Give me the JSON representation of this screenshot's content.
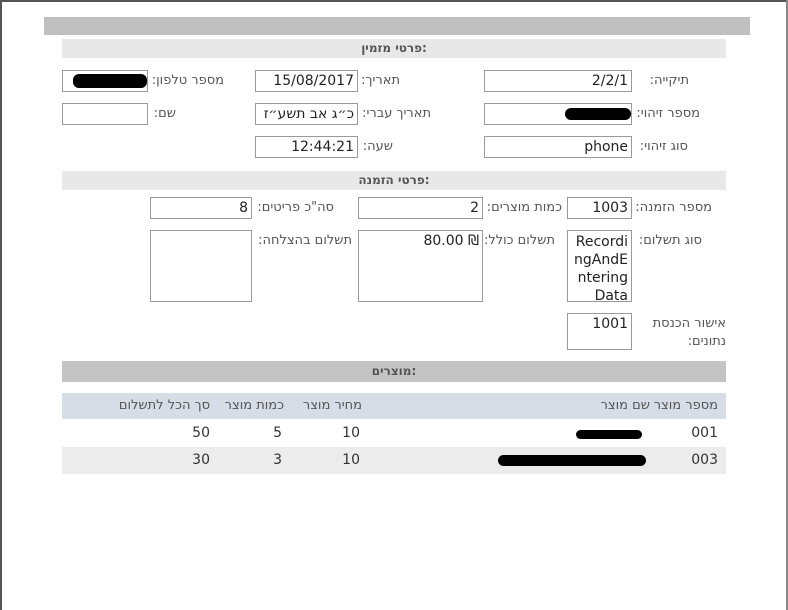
{
  "sections": {
    "invited": "פרטי מזמין:",
    "order": "פרטי הזמנה:",
    "products": "מוצרים:"
  },
  "customer": {
    "case_label": "תיקייה:",
    "case_value": "2/2/1",
    "date_label": "תאריך:",
    "date_value": "15/08/2017",
    "phone_label": "מספר טלפון:",
    "id_label": "מספר זיהוי:",
    "hebrew_date_label": "תאריך עברי:",
    "hebrew_date_value": "כ״ג אב תשע״ז",
    "name_label": "שם:",
    "name_value": "",
    "id_type_label": "סוג זיהוי:",
    "id_type_value": "phone",
    "time_label": "שעה:",
    "time_value": "12:44:21"
  },
  "order": {
    "order_no_label": "מספר הזמנה:",
    "order_no_value": "1003",
    "qty_label": "כמות מוצרים:",
    "qty_value": "2",
    "items_label": "סה\"כ פריטים:",
    "items_value": "8",
    "payment_type_label": "סוג תשלום:",
    "payment_type_value": "RecordingAndEnteringData",
    "total_label": "תשלום כולל:",
    "total_value": "80.00 ₪",
    "success_label": "תשלום בהצלחה:",
    "success_value": "",
    "approval_label": "אישור הכנסת נתונים:",
    "approval_value": "1001"
  },
  "products_table": {
    "headers": {
      "product_no": "מספר מוצר",
      "product_name": "שם מוצר",
      "price": "מחיר מוצר",
      "quantity": "כמות מוצר",
      "total": "סך הכל לתשלום"
    },
    "rows": [
      {
        "product_no": "001",
        "price": "10",
        "quantity": "5",
        "total": "50"
      },
      {
        "product_no": "003",
        "price": "10",
        "quantity": "3",
        "total": "30"
      }
    ]
  }
}
